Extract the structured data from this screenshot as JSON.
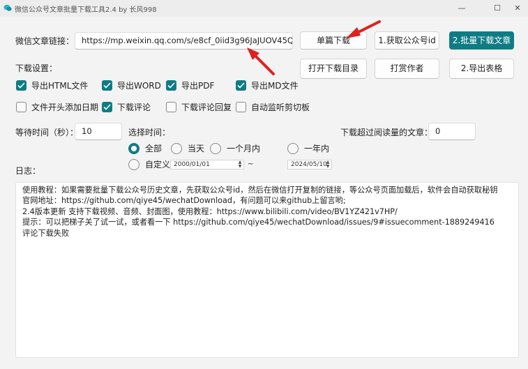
{
  "window": {
    "title": "微信公众号文章批量下载工具2.4 by 长风998",
    "minimize": "—",
    "maximize": "☐",
    "close": "✕"
  },
  "url_row": {
    "label": "微信文章链接：",
    "value": "https://mp.weixin.qq.com/s/e8cf_0iid3g96JaJUOV45Q"
  },
  "buttons": {
    "single_download": "单篇下载",
    "get_id": "1.获取公众号id",
    "batch_download": "2.批量下载文章",
    "open_dir": "打开下载目录",
    "donate": "打赏作者",
    "export_table": "2.导出表格"
  },
  "settings": {
    "title": "下载设置：",
    "checkboxes": [
      {
        "label": "导出HTML文件",
        "checked": true
      },
      {
        "label": "导出WORD",
        "checked": true
      },
      {
        "label": "导出PDF",
        "checked": true
      },
      {
        "label": "导出MD文件",
        "checked": true
      },
      {
        "label": "文件开头添加日期",
        "checked": false
      },
      {
        "label": "下载评论",
        "checked": true
      },
      {
        "label": "下载评论回复",
        "checked": false
      },
      {
        "label": "自动监听剪切板",
        "checked": false
      }
    ]
  },
  "wait": {
    "label": "等待时间（秒）：",
    "value": "10"
  },
  "time_select": {
    "label": "选择时间：",
    "options": [
      {
        "label": "全部",
        "selected": true
      },
      {
        "label": "当天",
        "selected": false
      },
      {
        "label": "一个月内",
        "selected": false
      },
      {
        "label": "一年内",
        "selected": false
      },
      {
        "label": "自定义",
        "selected": false
      }
    ],
    "date_start": "2000/01/01",
    "date_end": "2024/05/10",
    "separator": "~"
  },
  "read_threshold": {
    "label": "下载超过阅读量的文章：",
    "value": "0"
  },
  "log": {
    "label": "日志：",
    "lines": [
      "使用教程：如果需要批量下载公众号历史文章，先获取公众号id，然后在微信打开复制的链接，等公众号页面加载后，软件会自动获取秘钥",
      "官网地址：https://github.com/qiye45/wechatDownload，有问题可以来github上留言哟;",
      "2.4版本更新 支持下载视频、音频、封面图，使用教程：https://www.bilibili.com/video/BV1YZ421v7HP/",
      "提示：可以把梯子关了试一试，或者看一下 https://github.com/qiye45/wechatDownload/issues/9#issuecomment-1889249416",
      "评论下载失败"
    ]
  },
  "colors": {
    "accent": "#0f7c84",
    "arrow": "#e02020"
  }
}
